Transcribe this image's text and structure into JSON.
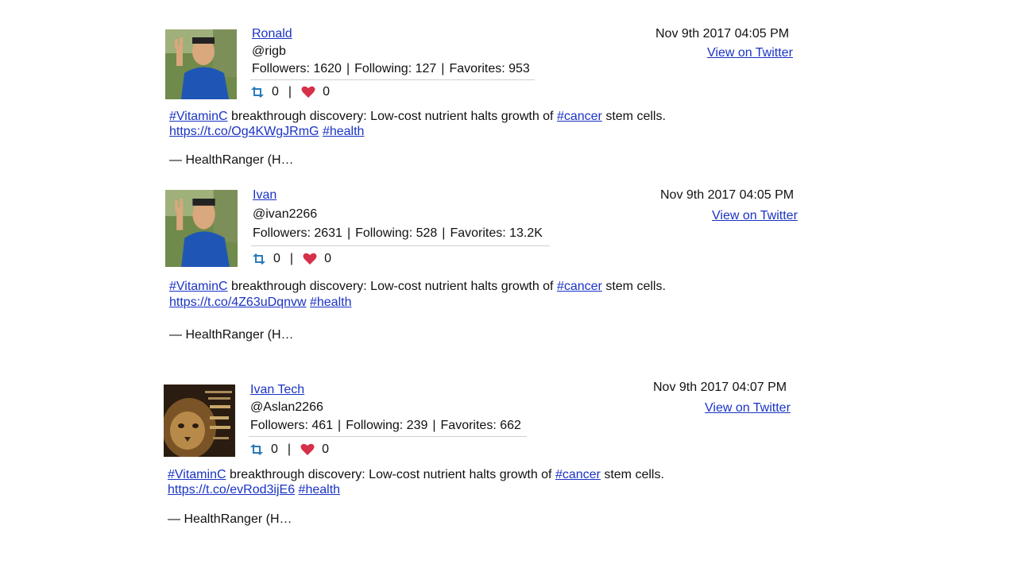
{
  "tweets": [
    {
      "name": "Ronald",
      "handle": "@rigb",
      "followers_label": "Followers: 1620",
      "following_label": "Following: 127",
      "favorites_label": "Favorites: 953",
      "retweets": "0",
      "likes": "0",
      "timestamp": "Nov 9th 2017 04:05 PM",
      "view_link": "View on Twitter",
      "hashtag1": "#VitaminC",
      "text_mid": " breakthrough discovery: Low-cost nutrient halts growth of ",
      "hashtag2": "#cancer",
      "text_end": " stem cells.",
      "url": "https://t.co/Og4KWgJRmG",
      "hashtag3": "#health",
      "attribution": "— HealthRanger (H…",
      "avatar_icon": "person-photo"
    },
    {
      "name": "Ivan",
      "handle": "@ivan2266",
      "followers_label": "Followers: 2631",
      "following_label": "Following: 528",
      "favorites_label": "Favorites: 13.2K",
      "retweets": "0",
      "likes": "0",
      "timestamp": "Nov 9th 2017 04:05 PM",
      "view_link": "View on Twitter",
      "hashtag1": "#VitaminC",
      "text_mid": " breakthrough discovery: Low-cost nutrient halts growth of ",
      "hashtag2": "#cancer",
      "text_end": " stem cells.",
      "url": "https://t.co/4Z63uDqnvw",
      "hashtag3": "#health",
      "attribution": "— HealthRanger (H…",
      "avatar_icon": "person-photo"
    },
    {
      "name": "Ivan Tech",
      "handle": "@Aslan2266",
      "followers_label": "Followers: 461",
      "following_label": "Following: 239",
      "favorites_label": "Favorites: 662",
      "retweets": "0",
      "likes": "0",
      "timestamp": "Nov 9th 2017 04:07 PM",
      "view_link": "View on Twitter",
      "hashtag1": "#VitaminC",
      "text_mid": " breakthrough discovery: Low-cost nutrient halts growth of ",
      "hashtag2": "#cancer",
      "text_end": " stem cells.",
      "url": "https://t.co/evRod3ijE6",
      "hashtag3": "#health",
      "attribution": "— HealthRanger (H…",
      "avatar_icon": "lion-photo"
    }
  ],
  "stats_separator": "|",
  "colors": {
    "link": "#1a33c4",
    "retweet_icon": "#2b7bb9",
    "heart_icon": "#d6304a",
    "divider": "#cfcfcf"
  }
}
